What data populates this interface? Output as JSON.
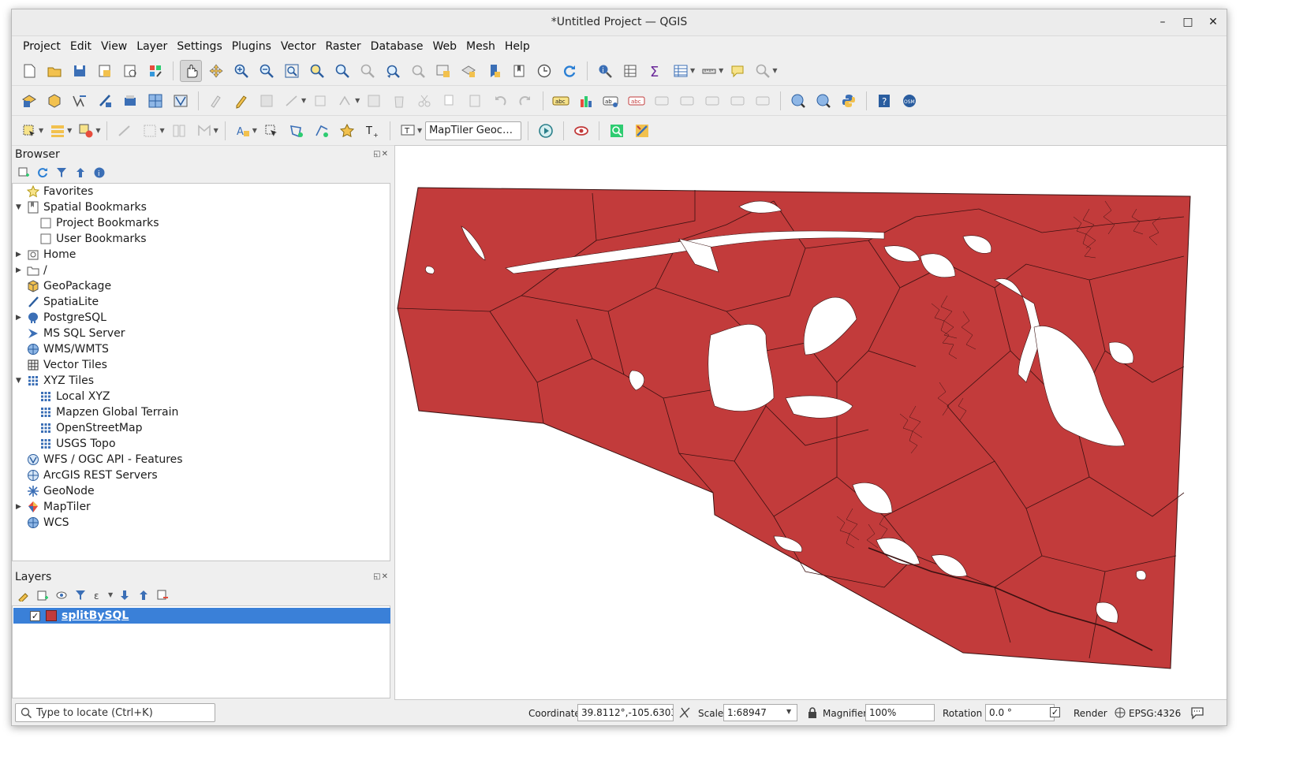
{
  "window": {
    "title": "*Untitled Project — QGIS",
    "minimize": "–",
    "maximize": "□",
    "close": "✕"
  },
  "menu": [
    "Project",
    "Edit",
    "View",
    "Layer",
    "Settings",
    "Plugins",
    "Vector",
    "Raster",
    "Database",
    "Web",
    "Mesh",
    "Help"
  ],
  "geocoder_placeholder": "MapTiler Geoc…",
  "browser": {
    "title": "Browser",
    "items": [
      {
        "label": "Favorites",
        "icon": "star-icon"
      },
      {
        "label": "Spatial Bookmarks",
        "icon": "bookmark-icon",
        "expanded": true
      },
      {
        "label": "Project Bookmarks",
        "icon": "folder-icon"
      },
      {
        "label": "User Bookmarks",
        "icon": "folder-icon"
      },
      {
        "label": "Home",
        "icon": "home-icon",
        "collapsed": true
      },
      {
        "label": "/",
        "icon": "folder-icon",
        "collapsed": true
      },
      {
        "label": "GeoPackage",
        "icon": "geopackage-icon"
      },
      {
        "label": "SpatiaLite",
        "icon": "spatialite-icon"
      },
      {
        "label": "PostgreSQL",
        "icon": "postgresql-icon",
        "collapsed": true
      },
      {
        "label": "MS SQL Server",
        "icon": "mssql-icon"
      },
      {
        "label": "WMS/WMTS",
        "icon": "globe-icon"
      },
      {
        "label": "Vector Tiles",
        "icon": "grid-icon"
      },
      {
        "label": "XYZ Tiles",
        "icon": "grid-icon",
        "expanded": true
      },
      {
        "label": "Local XYZ",
        "icon": "grid-icon"
      },
      {
        "label": "Mapzen Global Terrain",
        "icon": "grid-icon"
      },
      {
        "label": "OpenStreetMap",
        "icon": "grid-icon"
      },
      {
        "label": "USGS Topo",
        "icon": "grid-icon"
      },
      {
        "label": "WFS / OGC API - Features",
        "icon": "globe-icon"
      },
      {
        "label": "ArcGIS REST Servers",
        "icon": "globe-icon"
      },
      {
        "label": "GeoNode",
        "icon": "geonode-icon"
      },
      {
        "label": "MapTiler",
        "icon": "maptiler-icon",
        "collapsed": true
      },
      {
        "label": "WCS",
        "icon": "globe-icon"
      }
    ]
  },
  "layers": {
    "title": "Layers",
    "items": [
      {
        "name": "splitBySQL",
        "checked": "✓",
        "color": "#c23b3b"
      }
    ]
  },
  "status": {
    "locator_placeholder": "Type to locate (Ctrl+K)",
    "coordinate_label": "Coordinate",
    "coordinate_value": "39.8112°,-105.6303°",
    "scale_label": "Scale",
    "scale_value": "1:68947",
    "magnifier_label": "Magnifier",
    "magnifier_value": "100%",
    "rotation_label": "Rotation",
    "rotation_value": "0.0 °",
    "render_label": "Render",
    "render_checked": "✓",
    "crs": "EPSG:4326"
  },
  "colors": {
    "polygon_fill": "#c23b3b",
    "polygon_stroke": "#3a1111",
    "selection": "#3a80d8"
  }
}
